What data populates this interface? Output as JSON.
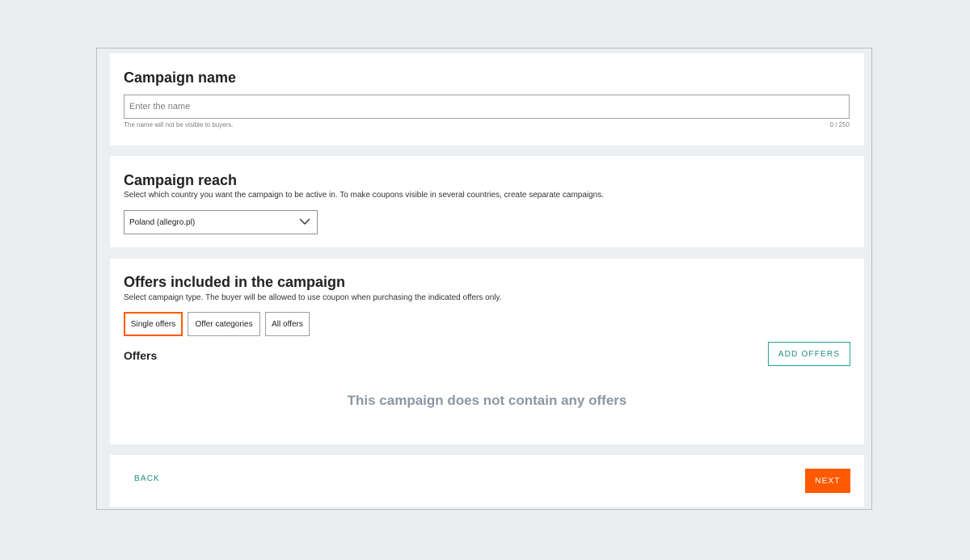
{
  "campaign_name": {
    "title": "Campaign name",
    "input_placeholder": "Enter the name",
    "input_value": "",
    "hint": "The name will not be visible to buyers.",
    "counter": "0 / 250"
  },
  "campaign_reach": {
    "title": "Campaign reach",
    "description": "Select which country you want the campaign to be active in. To make coupons visible in several countries, create separate campaigns.",
    "selected_country": "Poland (allegro.pl)"
  },
  "offers": {
    "title": "Offers included in the campaign",
    "description": "Select campaign type. The buyer will be allowed to use coupon when purchasing the indicated offers only.",
    "types": [
      "Single offers",
      "Offer categories",
      "All offers"
    ],
    "active_type": "Single offers",
    "offers_label": "Offers",
    "add_offers_label": "ADD OFFERS",
    "empty_message": "This campaign does not contain any offers"
  },
  "footer": {
    "back_label": "BACK",
    "next_label": "NEXT"
  },
  "colors": {
    "accent": "#ff5a00",
    "teal": "#1f8f7d",
    "background": "#eaeef1"
  }
}
